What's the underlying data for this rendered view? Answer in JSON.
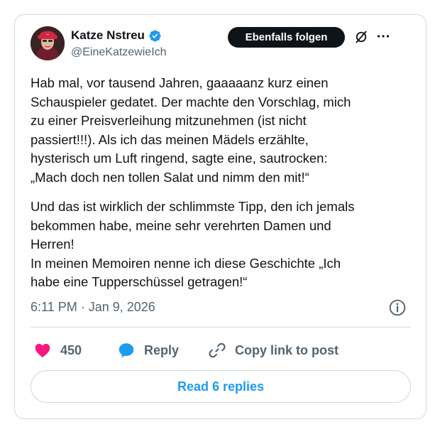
{
  "author": {
    "name": "Katze Nstreu",
    "handle": "@EineKatzewieIch"
  },
  "header": {
    "follow_label": "Ebenfalls folgen"
  },
  "tweet": {
    "paragraph1": "Hab mal, vor tausend Jahren, gaaaaanz kurz einen\nSchauspieler gedatet. Der machte den Vorschlag, mich\nzu einer Preisverleihung mitzunehmen (ist nicht\npassiert!!!). Als ich das meinen Mädels erzählte,\nhysterisch um Luft ringend, sagte eine, sautrocken:\n„Mach doch nen tollen Salat und nimm den mit!“",
    "paragraph2": "Und das ist wirklich der schlimmste Tipp, den ich jemals\nbekommen habe, meine sehr verehrten Damen und\nHerren!\nIn meinen Memoiren nenne ich diese Geschichte „Ich\nhabe eine Tupperschüssel getragen!“",
    "timestamp": "6:11 PM · Jan 9, 2026"
  },
  "actions": {
    "like_count": "450",
    "reply_label": "Reply",
    "copy_label": "Copy link to post"
  },
  "footer": {
    "read_replies_label": "Read 6 replies"
  },
  "colors": {
    "like": "#f91880",
    "reply": "#1d9bf0",
    "link": "#1d9bf0",
    "verified": "#1d9bf0"
  }
}
